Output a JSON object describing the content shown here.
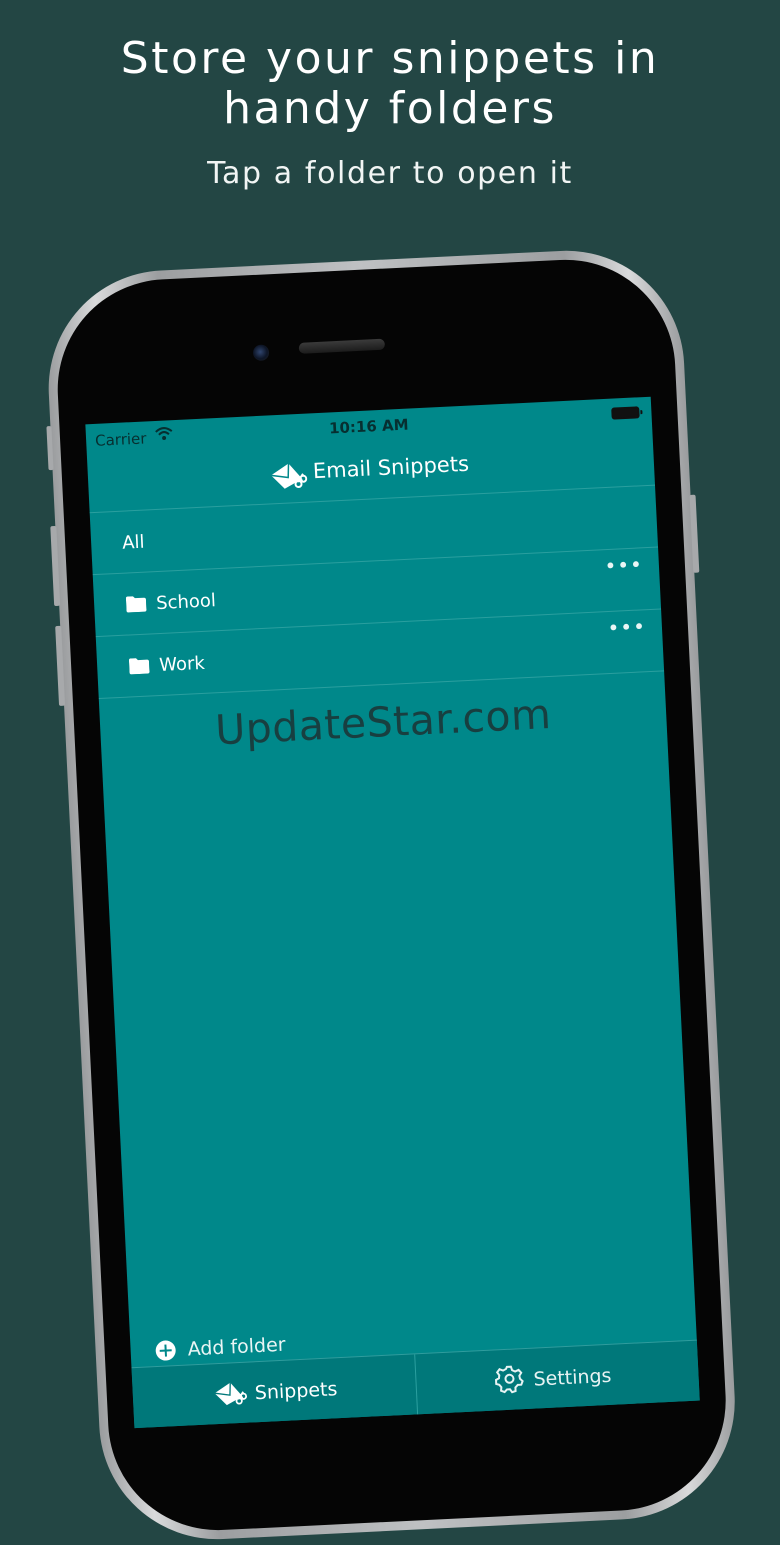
{
  "promo": {
    "headline_line1": "Store your snippets in",
    "headline_line2": "handy folders",
    "subheadline": "Tap a folder to open it"
  },
  "status_bar": {
    "carrier": "Carrier",
    "time": "10:16 AM",
    "icons": [
      "wifi-icon",
      "battery-icon"
    ]
  },
  "nav": {
    "title": "Email Snippets",
    "icon": "envelope-scissors-icon"
  },
  "folders": {
    "all_label": "All",
    "items": [
      {
        "label": "School",
        "icon": "folder-icon",
        "menu": "•••"
      },
      {
        "label": "Work",
        "icon": "folder-icon",
        "menu": "•••"
      }
    ]
  },
  "watermark": "UpdateStar.com",
  "add_folder": {
    "label": "Add folder",
    "icon": "plus-circle-icon"
  },
  "tabs": [
    {
      "label": "Snippets",
      "icon": "envelope-scissors-icon",
      "selected": true
    },
    {
      "label": "Settings",
      "icon": "gear-icon",
      "selected": false
    }
  ],
  "colors": {
    "background": "#234644",
    "screen": "#00888a",
    "tabbar": "#00787a",
    "text": "#ffffff"
  }
}
